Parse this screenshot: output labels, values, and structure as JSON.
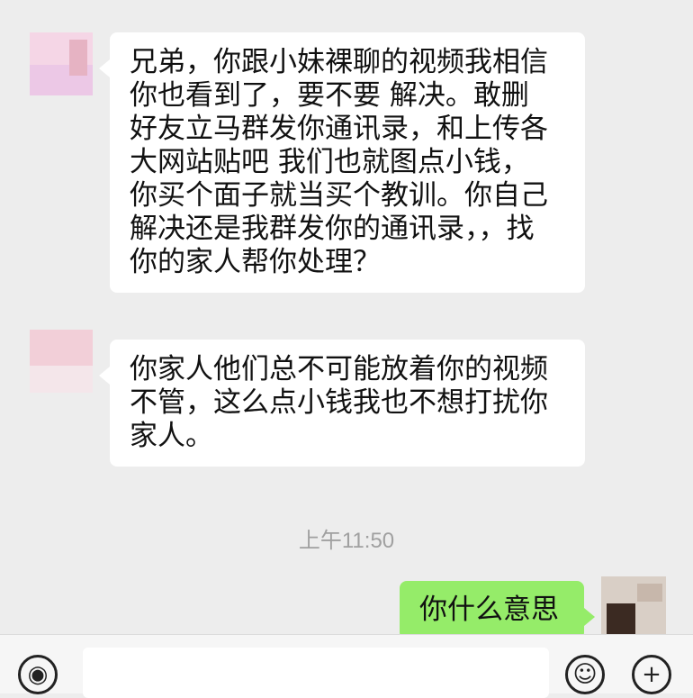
{
  "messages": [
    {
      "text": "兄弟，你跟小妹裸聊的视频我相信\n你也看到了，要不要  解决。敢删\n好友立马群发你通讯录，和上传各\n大网站贴吧 我们也就图点小钱，\n你买个面子就当买个教训。你自己\n解决还是我群发你的通讯录，，找\n你的家人帮你处理？"
    },
    {
      "text": "你家人他们总不可能放着你的视频\n不管，这么点小钱我也不想打扰你\n家人。"
    },
    {
      "text": "你什么意思"
    }
  ],
  "time": "上午11:50",
  "icons": {
    "voice": "voice-icon",
    "emoji": "emoji-icon",
    "plus": "plus-icon"
  }
}
